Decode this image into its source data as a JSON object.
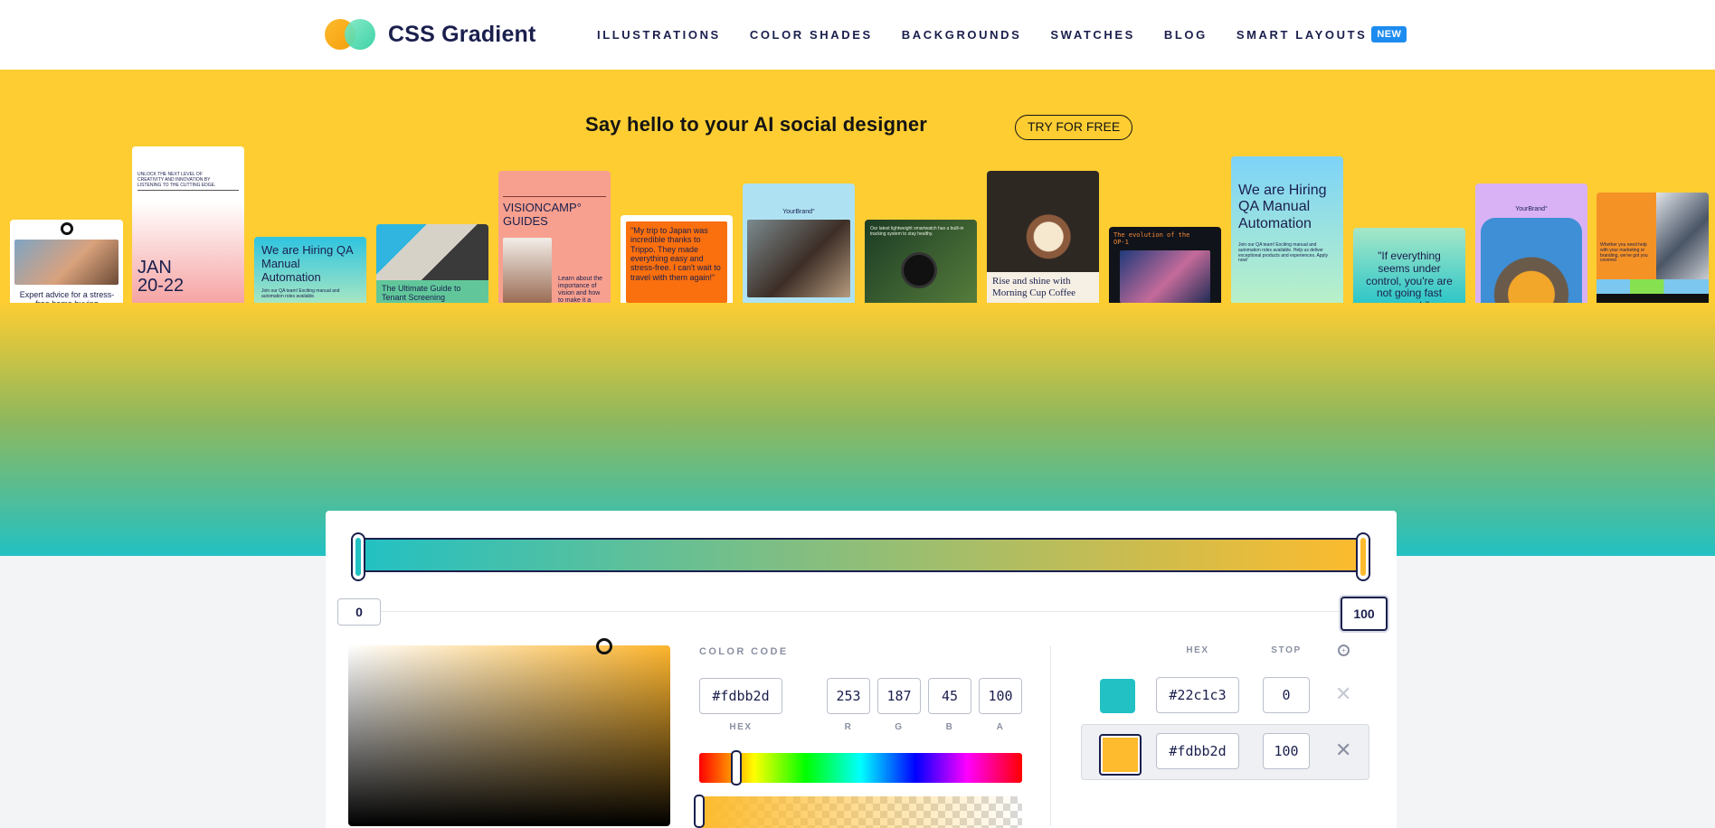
{
  "header": {
    "logo_text": "CSS Gradient",
    "nav": [
      {
        "label": "ILLUSTRATIONS"
      },
      {
        "label": "COLOR SHADES"
      },
      {
        "label": "BACKGROUNDS"
      },
      {
        "label": "SWATCHES"
      },
      {
        "label": "BLOG"
      },
      {
        "label": "SMART LAYOUTS"
      }
    ],
    "badge": "NEW"
  },
  "banner": {
    "title": "Say hello to your AI social designer",
    "cta": "TRY FOR FREE",
    "cards": {
      "c1": "Expert advice for a stress-free home buying experience",
      "c2_small": "UNLOCK THE NEXT LEVEL OF CREATIVITY AND INNOVATION BY LISTENING TO THE CUTTING EDGE.",
      "c2_big": "JAN\n20-22",
      "c3": "We are Hiring QA Manual Automation",
      "c3_small": "Join our QA team! Exciting manual and automation roles available.",
      "c4": "The Ultimate Guide to Tenant Screening",
      "c5_title": "VISIONCAMP° GUIDES",
      "c5_small": "Learn about the importance of vision and how to make it a",
      "c6": "\"My trip to Japan was incredible thanks to Trippo. They made everything easy and stress-free. I can't wait to travel with them again!\"",
      "c7_brand": "YourBrand°",
      "c8": "Our latest lightweight smartwatch has a built-in tracking system to stay healthy.",
      "c9": "Rise and shine with Morning Cup Coffee",
      "c10": "The evolution of the OP-1",
      "c11": "We are Hiring QA Manual Automation",
      "c11_small": "Join our QA team! Exciting manual and automation roles available. Help us deliver exceptional products and experiences. Apply now!",
      "c12": "\"If everything seems under control, you're are not going fast enough\"",
      "c13_brand": "YourBrand°",
      "c14": "Whether you need help with your marketing or branding, we've got you covered"
    }
  },
  "editor": {
    "stop_left": "0",
    "stop_right": "100",
    "color_code_label": "COLOR CODE",
    "hex_value": "#fdbb2d",
    "hex_label": "HEX",
    "rgba": [
      {
        "label": "R",
        "value": "253"
      },
      {
        "label": "G",
        "value": "187"
      },
      {
        "label": "B",
        "value": "45"
      },
      {
        "label": "A",
        "value": "100"
      }
    ],
    "stops_header": {
      "hex": "HEX",
      "stop": "STOP"
    },
    "stops": [
      {
        "hex": "#22c1c3",
        "stop": "0"
      },
      {
        "hex": "#fdbb2d",
        "stop": "100"
      }
    ],
    "colors": {
      "start": "#22c1c3",
      "end": "#fdbb2d",
      "banner": "#fdcd32",
      "ink": "#1a1f4d",
      "badge": "#1d8cf0"
    }
  }
}
